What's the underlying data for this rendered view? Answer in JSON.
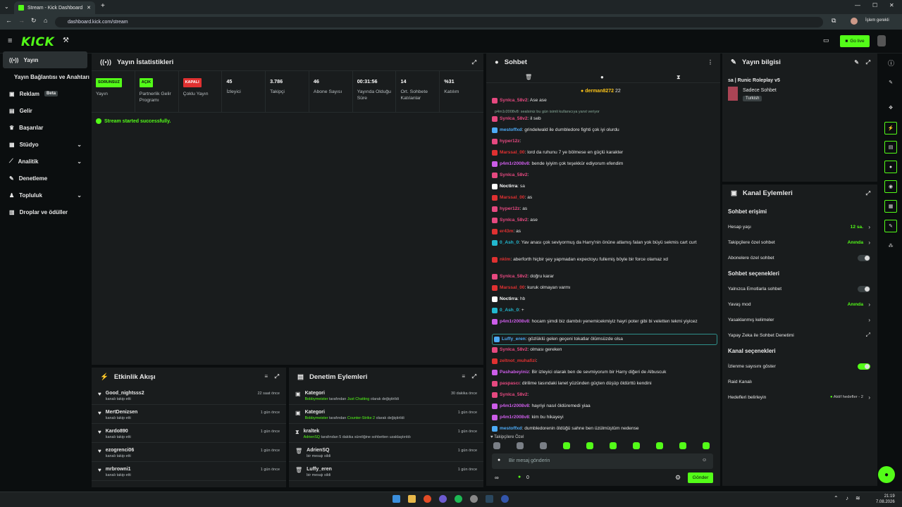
{
  "browser": {
    "tab_title": "Stream - Kick Dashboard",
    "url": "dashboard.kick.com/stream",
    "profile_label": "İşlem gerekli"
  },
  "header": {
    "logo": "KICK",
    "go_live": "Go live"
  },
  "sidebar": {
    "items": [
      {
        "label": "Yayın",
        "icon": "stream-icon"
      },
      {
        "label": "Yayın Bağlantısı ve Anahtarı",
        "icon": ""
      },
      {
        "label": "Reklam",
        "badge": "Beta",
        "icon": "ad-icon"
      },
      {
        "label": "Gelir",
        "icon": "money-icon"
      },
      {
        "label": "Başarılar",
        "icon": "trophy-icon"
      },
      {
        "label": "Stüdyo",
        "icon": "studio-icon"
      },
      {
        "label": "Analitik",
        "icon": "chart-icon"
      },
      {
        "label": "Denetleme",
        "icon": "wrench-icon"
      },
      {
        "label": "Topluluk",
        "icon": "people-icon"
      },
      {
        "label": "Droplar ve ödüller",
        "icon": "gift-icon"
      }
    ]
  },
  "stats": {
    "title": "Yayın İstatistikleri",
    "items": [
      {
        "badge": "SORUNSUZ",
        "badge_color": "#53fc18",
        "label": "Yayın"
      },
      {
        "badge": "AÇIK",
        "badge_color": "#53fc18",
        "label": "Partnerlik Gelir Programı"
      },
      {
        "badge": "KAPALI",
        "badge_color": "#e03131",
        "label": "Çoklu Yayın"
      },
      {
        "value": "45",
        "label": "İzleyici"
      },
      {
        "value": "3.786",
        "label": "Takipçi"
      },
      {
        "value": "46",
        "label": "Abone Sayısı"
      },
      {
        "value": "00:31:56",
        "label": "Yayında Olduğu Süre"
      },
      {
        "value": "14",
        "label": "Ort. Sohbete Katılanlar"
      },
      {
        "value": "%31",
        "label": "Katılım"
      }
    ],
    "success": "Stream started successfully."
  },
  "activity": {
    "title": "Etkinlik Akışı",
    "items": [
      {
        "name": "Good_nightsss2",
        "sub": "kanalı takip etti",
        "time": "22 saat önce"
      },
      {
        "name": "MertDenizsen",
        "sub": "kanalı takip etti",
        "time": "1 gün önce"
      },
      {
        "name": "Kardo890",
        "sub": "kanalı takip etti",
        "time": "1 gün önce"
      },
      {
        "name": "ezogrenci06",
        "sub": "kanalı takip etti",
        "time": "1 gün önce"
      },
      {
        "name": "mrbrowni1",
        "sub": "kanalı takip etti",
        "time": "1 gün önce"
      }
    ]
  },
  "moderation": {
    "title": "Denetim Eylemleri",
    "items": [
      {
        "title": "Kategori",
        "actor": "Bobbymeister",
        "mid": "tarafından",
        "target": "Just Chatting",
        "tail": "olarak değiştirildi",
        "time": "30 dakika önce"
      },
      {
        "title": "Kategori",
        "actor": "Bobbymeister",
        "mid": "tarafından",
        "target": "Counter-Strike 2",
        "tail": "olarak değiştirildi",
        "time": "1 gün önce"
      },
      {
        "title": "kraltek",
        "actor": "AdrienSQ",
        "mid": "tarafından 5 dakika süreliğine sohbetten uzaklaştırıldı",
        "target": "",
        "tail": "",
        "time": "1 gün önce"
      },
      {
        "title": "AdrienSQ",
        "actor": "",
        "mid": "bir mesajı sildi",
        "target": "",
        "tail": "",
        "time": "1 gün önce"
      },
      {
        "title": "Luffy_eren",
        "actor": "",
        "mid": "bir mesajı sildi",
        "target": "",
        "tail": "",
        "time": "1 gün önce"
      }
    ]
  },
  "chat": {
    "title": "Sohbet",
    "pinned_user": "derman8272",
    "pinned_count": "22",
    "system": "p4m1r2008v8: sealsiniz bu gün isimli kullanıcıya yanıt veriyor",
    "messages": [
      {
        "user": "Synlca_58v2",
        "color": "#e64980",
        "text": "Ase ase"
      },
      {
        "user": "Synlca_58v2",
        "color": "#e64980",
        "text": "il seb"
      },
      {
        "user": "mestoffxd",
        "color": "#4dabf7",
        "text": "grindelwald ile dumbledore fighti çok iyi olurdu"
      },
      {
        "user": "hyper12z",
        "color": "#e64980",
        "text": ""
      },
      {
        "user": "Marssal_00",
        "color": "#e03131",
        "text": "lord da ruhunu 7 ye bölmese en güçlü karakter"
      },
      {
        "user": "p4m1r2008v8",
        "color": "#cc5de8",
        "text": "bende iyiyim çok teşekkür ediyorum efendim"
      },
      {
        "user": "Synlca_58v2",
        "color": "#e64980",
        "text": ""
      },
      {
        "user": "Noctirra",
        "color": "#ffffff",
        "text": "sa"
      },
      {
        "user": "Marssal_00",
        "color": "#e03131",
        "text": "as"
      },
      {
        "user": "hyper12z",
        "color": "#e64980",
        "text": "as"
      },
      {
        "user": "Synlca_58v2",
        "color": "#e64980",
        "text": "ase"
      },
      {
        "user": "er43m",
        "color": "#e03131",
        "text": "as"
      },
      {
        "user": "0_Ash_0",
        "color": "#22b8cf",
        "text": "Yav anası çok seviyormuş da Harry'nin önüne atlamış falan yok büyü sekmis cart curt"
      },
      {
        "user": "nklm",
        "color": "#e03131",
        "text": "aberforth hiçbir şey yapmadan expectoyu fullemiş böyle bir force olamaz xd"
      },
      {
        "user": "Synlca_58v2",
        "color": "#e64980",
        "text": "doğru karar"
      },
      {
        "user": "Marssal_00",
        "color": "#e03131",
        "text": "kuruk olmayan varmı"
      },
      {
        "user": "Noctirra",
        "color": "#ffffff",
        "text": "hb"
      },
      {
        "user": "0_Ash_0",
        "color": "#22b8cf",
        "text": "+"
      },
      {
        "user": "p4m1r2008v8",
        "color": "#cc5de8",
        "text": "hocam şimdi biz dambılı yenemicekmiyiz hayri poter gibi bi veletten tekmi yiyicez"
      },
      {
        "user": "Luffy_eren",
        "color": "#4dabf7",
        "text": "gözlüklü gelen geçeni tokatlar ölümsüzde olsa"
      },
      {
        "user": "Synlca_58v2",
        "color": "#e64980",
        "text": "olması gereken"
      },
      {
        "user": "zeltnot_muhafizi",
        "color": "#e03131",
        "text": ""
      },
      {
        "user": "Pashabeyiniz",
        "color": "#cc5de8",
        "text": "Bir izleyici olarak ben de sevmiyorum bir Harry diğeri de Albuscuk"
      },
      {
        "user": "paspascı",
        "color": "#e64980",
        "text": "dirilime tasındaki lanet yüzünden güçten düşüp öldürttü kendini"
      },
      {
        "user": "Synlca_58v2",
        "color": "#e64980",
        "text": ""
      },
      {
        "user": "p4m1r2008v8",
        "color": "#cc5de8",
        "text": "hayriyi nasıl öldüremedi yiaa"
      },
      {
        "user": "p4m1r2008v8",
        "color": "#cc5de8",
        "text": "kim bu hikayeyi"
      },
      {
        "user": "mestoffxd",
        "color": "#4dabf7",
        "text": "dumbledorenin öldüğü sahne ben üzülmüştüm nedense"
      }
    ],
    "followers_label": "Takipçilere Özel",
    "input_placeholder": "Bir mesaj gönderin",
    "points": "0",
    "send": "Gönder"
  },
  "stream_info": {
    "title": "Yayın bilgisi",
    "stream_title": "sa | Runic Roleplay v5",
    "mode": "Sadece Sohbet",
    "lang": "Turkish"
  },
  "channel": {
    "title": "Kanal Eylemleri",
    "chat_access": "Sohbet erişimi",
    "rows1": [
      {
        "label": "Hesap yaşı",
        "value": "12 sa."
      },
      {
        "label": "Takipçilere özel sohbet",
        "value": "Anında"
      },
      {
        "label": "Abonelere özel sohbet",
        "value": ""
      }
    ],
    "chat_options": "Sohbet seçenekleri",
    "rows2": [
      {
        "label": "Yalnızca Emotlarla sohbet",
        "value": ""
      },
      {
        "label": "Yavaş mod",
        "value": "Anında"
      },
      {
        "label": "Yasaklanmış kelimeler",
        "value": ""
      },
      {
        "label": "Yapay Zeka ile Sohbet Denetimi",
        "value": ""
      }
    ],
    "channel_options": "Kanal seçenekleri",
    "rows3": [
      {
        "label": "İzlenme sayısını göster",
        "value": ""
      },
      {
        "label": "Raid Kanalı",
        "value": ""
      },
      {
        "label": "Hedefleri belirleyin",
        "value": "Aktif hedefler - 2"
      }
    ]
  },
  "taskbar": {
    "time": "21:19",
    "date": "7.08.2026"
  }
}
